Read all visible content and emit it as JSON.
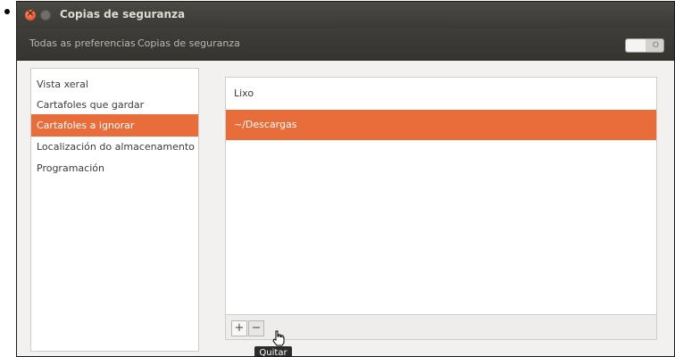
{
  "window": {
    "title": "Copias de seguranza"
  },
  "toolbar": {
    "breadcrumbs": [
      "Todas as preferencias",
      "Copias de seguranza"
    ],
    "toggle_label": "O"
  },
  "sidebar": {
    "items": [
      {
        "label": "Vista xeral",
        "selected": false
      },
      {
        "label": "Cartafoles que gardar",
        "selected": false
      },
      {
        "label": "Cartafoles a ignorar",
        "selected": true
      },
      {
        "label": "Localización do almacenamento",
        "selected": false
      },
      {
        "label": "Programación",
        "selected": false
      }
    ]
  },
  "folders": {
    "rows": [
      {
        "label": "Lixo",
        "selected": false
      },
      {
        "label": "~/Descargas",
        "selected": true
      }
    ]
  },
  "buttons": {
    "add": "+",
    "remove": "−"
  },
  "tooltip": {
    "text": "Quitar"
  },
  "colors": {
    "accent": "#e96c3b",
    "titlebar": "#3c3b37"
  }
}
